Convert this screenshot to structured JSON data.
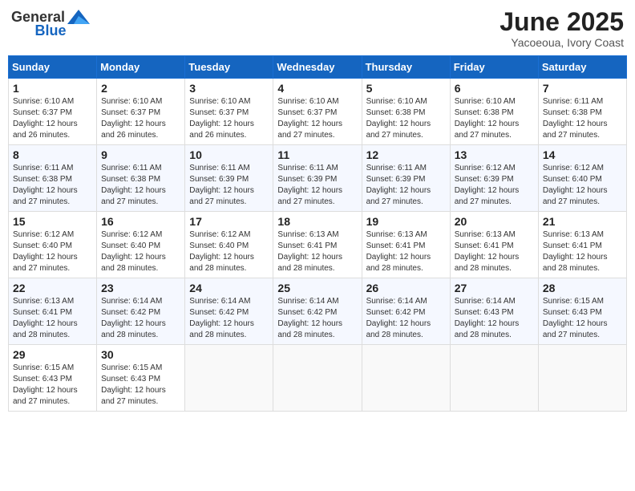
{
  "logo": {
    "general": "General",
    "blue": "Blue"
  },
  "title": {
    "month_year": "June 2025",
    "location": "Yacoeoua, Ivory Coast"
  },
  "weekdays": [
    "Sunday",
    "Monday",
    "Tuesday",
    "Wednesday",
    "Thursday",
    "Friday",
    "Saturday"
  ],
  "weeks": [
    [
      {
        "day": "1",
        "sunrise": "6:10 AM",
        "sunset": "6:37 PM",
        "daylight": "12 hours and 26 minutes."
      },
      {
        "day": "2",
        "sunrise": "6:10 AM",
        "sunset": "6:37 PM",
        "daylight": "12 hours and 26 minutes."
      },
      {
        "day": "3",
        "sunrise": "6:10 AM",
        "sunset": "6:37 PM",
        "daylight": "12 hours and 26 minutes."
      },
      {
        "day": "4",
        "sunrise": "6:10 AM",
        "sunset": "6:37 PM",
        "daylight": "12 hours and 27 minutes."
      },
      {
        "day": "5",
        "sunrise": "6:10 AM",
        "sunset": "6:38 PM",
        "daylight": "12 hours and 27 minutes."
      },
      {
        "day": "6",
        "sunrise": "6:10 AM",
        "sunset": "6:38 PM",
        "daylight": "12 hours and 27 minutes."
      },
      {
        "day": "7",
        "sunrise": "6:11 AM",
        "sunset": "6:38 PM",
        "daylight": "12 hours and 27 minutes."
      }
    ],
    [
      {
        "day": "8",
        "sunrise": "6:11 AM",
        "sunset": "6:38 PM",
        "daylight": "12 hours and 27 minutes."
      },
      {
        "day": "9",
        "sunrise": "6:11 AM",
        "sunset": "6:38 PM",
        "daylight": "12 hours and 27 minutes."
      },
      {
        "day": "10",
        "sunrise": "6:11 AM",
        "sunset": "6:39 PM",
        "daylight": "12 hours and 27 minutes."
      },
      {
        "day": "11",
        "sunrise": "6:11 AM",
        "sunset": "6:39 PM",
        "daylight": "12 hours and 27 minutes."
      },
      {
        "day": "12",
        "sunrise": "6:11 AM",
        "sunset": "6:39 PM",
        "daylight": "12 hours and 27 minutes."
      },
      {
        "day": "13",
        "sunrise": "6:12 AM",
        "sunset": "6:39 PM",
        "daylight": "12 hours and 27 minutes."
      },
      {
        "day": "14",
        "sunrise": "6:12 AM",
        "sunset": "6:40 PM",
        "daylight": "12 hours and 27 minutes."
      }
    ],
    [
      {
        "day": "15",
        "sunrise": "6:12 AM",
        "sunset": "6:40 PM",
        "daylight": "12 hours and 27 minutes."
      },
      {
        "day": "16",
        "sunrise": "6:12 AM",
        "sunset": "6:40 PM",
        "daylight": "12 hours and 28 minutes."
      },
      {
        "day": "17",
        "sunrise": "6:12 AM",
        "sunset": "6:40 PM",
        "daylight": "12 hours and 28 minutes."
      },
      {
        "day": "18",
        "sunrise": "6:13 AM",
        "sunset": "6:41 PM",
        "daylight": "12 hours and 28 minutes."
      },
      {
        "day": "19",
        "sunrise": "6:13 AM",
        "sunset": "6:41 PM",
        "daylight": "12 hours and 28 minutes."
      },
      {
        "day": "20",
        "sunrise": "6:13 AM",
        "sunset": "6:41 PM",
        "daylight": "12 hours and 28 minutes."
      },
      {
        "day": "21",
        "sunrise": "6:13 AM",
        "sunset": "6:41 PM",
        "daylight": "12 hours and 28 minutes."
      }
    ],
    [
      {
        "day": "22",
        "sunrise": "6:13 AM",
        "sunset": "6:41 PM",
        "daylight": "12 hours and 28 minutes."
      },
      {
        "day": "23",
        "sunrise": "6:14 AM",
        "sunset": "6:42 PM",
        "daylight": "12 hours and 28 minutes."
      },
      {
        "day": "24",
        "sunrise": "6:14 AM",
        "sunset": "6:42 PM",
        "daylight": "12 hours and 28 minutes."
      },
      {
        "day": "25",
        "sunrise": "6:14 AM",
        "sunset": "6:42 PM",
        "daylight": "12 hours and 28 minutes."
      },
      {
        "day": "26",
        "sunrise": "6:14 AM",
        "sunset": "6:42 PM",
        "daylight": "12 hours and 28 minutes."
      },
      {
        "day": "27",
        "sunrise": "6:14 AM",
        "sunset": "6:43 PM",
        "daylight": "12 hours and 28 minutes."
      },
      {
        "day": "28",
        "sunrise": "6:15 AM",
        "sunset": "6:43 PM",
        "daylight": "12 hours and 27 minutes."
      }
    ],
    [
      {
        "day": "29",
        "sunrise": "6:15 AM",
        "sunset": "6:43 PM",
        "daylight": "12 hours and 27 minutes."
      },
      {
        "day": "30",
        "sunrise": "6:15 AM",
        "sunset": "6:43 PM",
        "daylight": "12 hours and 27 minutes."
      },
      null,
      null,
      null,
      null,
      null
    ]
  ]
}
